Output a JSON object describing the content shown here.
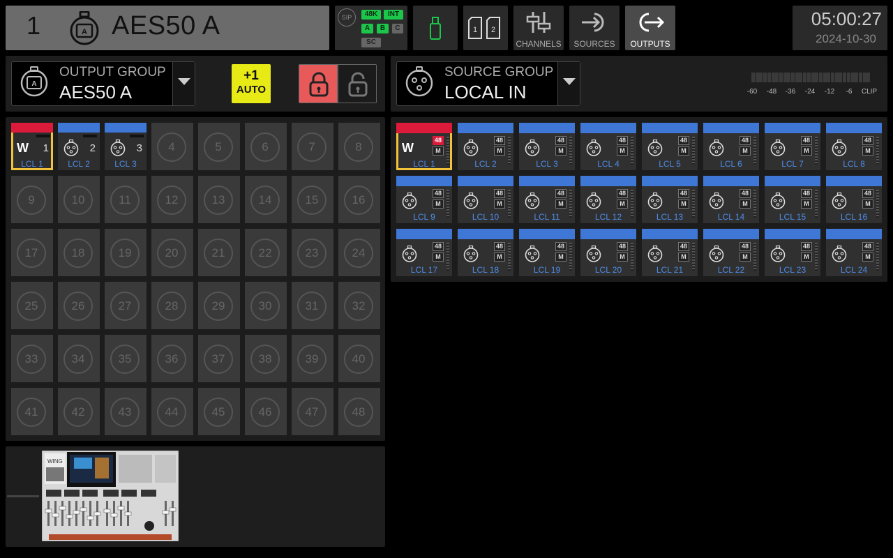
{
  "header": {
    "channel_number": "1",
    "title": "AES50 A",
    "status": {
      "sip": "SIP",
      "rate": "48K",
      "clock": "INT",
      "a": "A",
      "b": "B",
      "c": "C",
      "sc": "SC"
    },
    "tools": {
      "channels": "CHANNELS",
      "sources": "SOURCES",
      "outputs": "OUTPUTS"
    },
    "clock": {
      "time": "05:00:27",
      "date": "2024-10-30"
    }
  },
  "output_panel": {
    "group_label": "OUTPUT GROUP",
    "group_value": "AES50 A",
    "auto_plus": "+1",
    "auto_label": "AUTO"
  },
  "source_panel": {
    "group_label": "SOURCE GROUP",
    "group_value": "LOCAL IN",
    "meter_labels": [
      "-60",
      "-48",
      "-36",
      "-24",
      "-12",
      "-6",
      "CLIP"
    ]
  },
  "outputs": {
    "assigned": [
      {
        "num": "1",
        "label": "LCL 1",
        "type": "wing",
        "selected": true
      },
      {
        "num": "2",
        "label": "LCL 2",
        "type": "xlr"
      },
      {
        "num": "3",
        "label": "LCL 3",
        "type": "xlr"
      }
    ],
    "empty": [
      "4",
      "5",
      "6",
      "7",
      "8",
      "9",
      "10",
      "11",
      "12",
      "13",
      "14",
      "15",
      "16",
      "17",
      "18",
      "19",
      "20",
      "21",
      "22",
      "23",
      "24",
      "25",
      "26",
      "27",
      "28",
      "29",
      "30",
      "31",
      "32",
      "33",
      "34",
      "35",
      "36",
      "37",
      "38",
      "39",
      "40",
      "41",
      "42",
      "43",
      "44",
      "45",
      "46",
      "47",
      "48"
    ]
  },
  "sources": {
    "phantom": "48",
    "mute": "M",
    "items": [
      "LCL 1",
      "LCL 2",
      "LCL 3",
      "LCL 4",
      "LCL 5",
      "LCL 6",
      "LCL 7",
      "LCL 8",
      "LCL 9",
      "LCL 10",
      "LCL 11",
      "LCL 12",
      "LCL 13",
      "LCL 14",
      "LCL 15",
      "LCL 16",
      "LCL 17",
      "LCL 18",
      "LCL 19",
      "LCL 20",
      "LCL 21",
      "LCL 22",
      "LCL 23",
      "LCL 24"
    ]
  },
  "preview": {
    "device_brand": "WING"
  },
  "colors": {
    "accent_blue": "#3f77d6",
    "accent_red": "#dc1a3a",
    "select_yellow": "#f2c33a",
    "status_green": "#1cc64a",
    "auto_yellow": "#e8ea16",
    "lock_red": "#e85a5a"
  }
}
